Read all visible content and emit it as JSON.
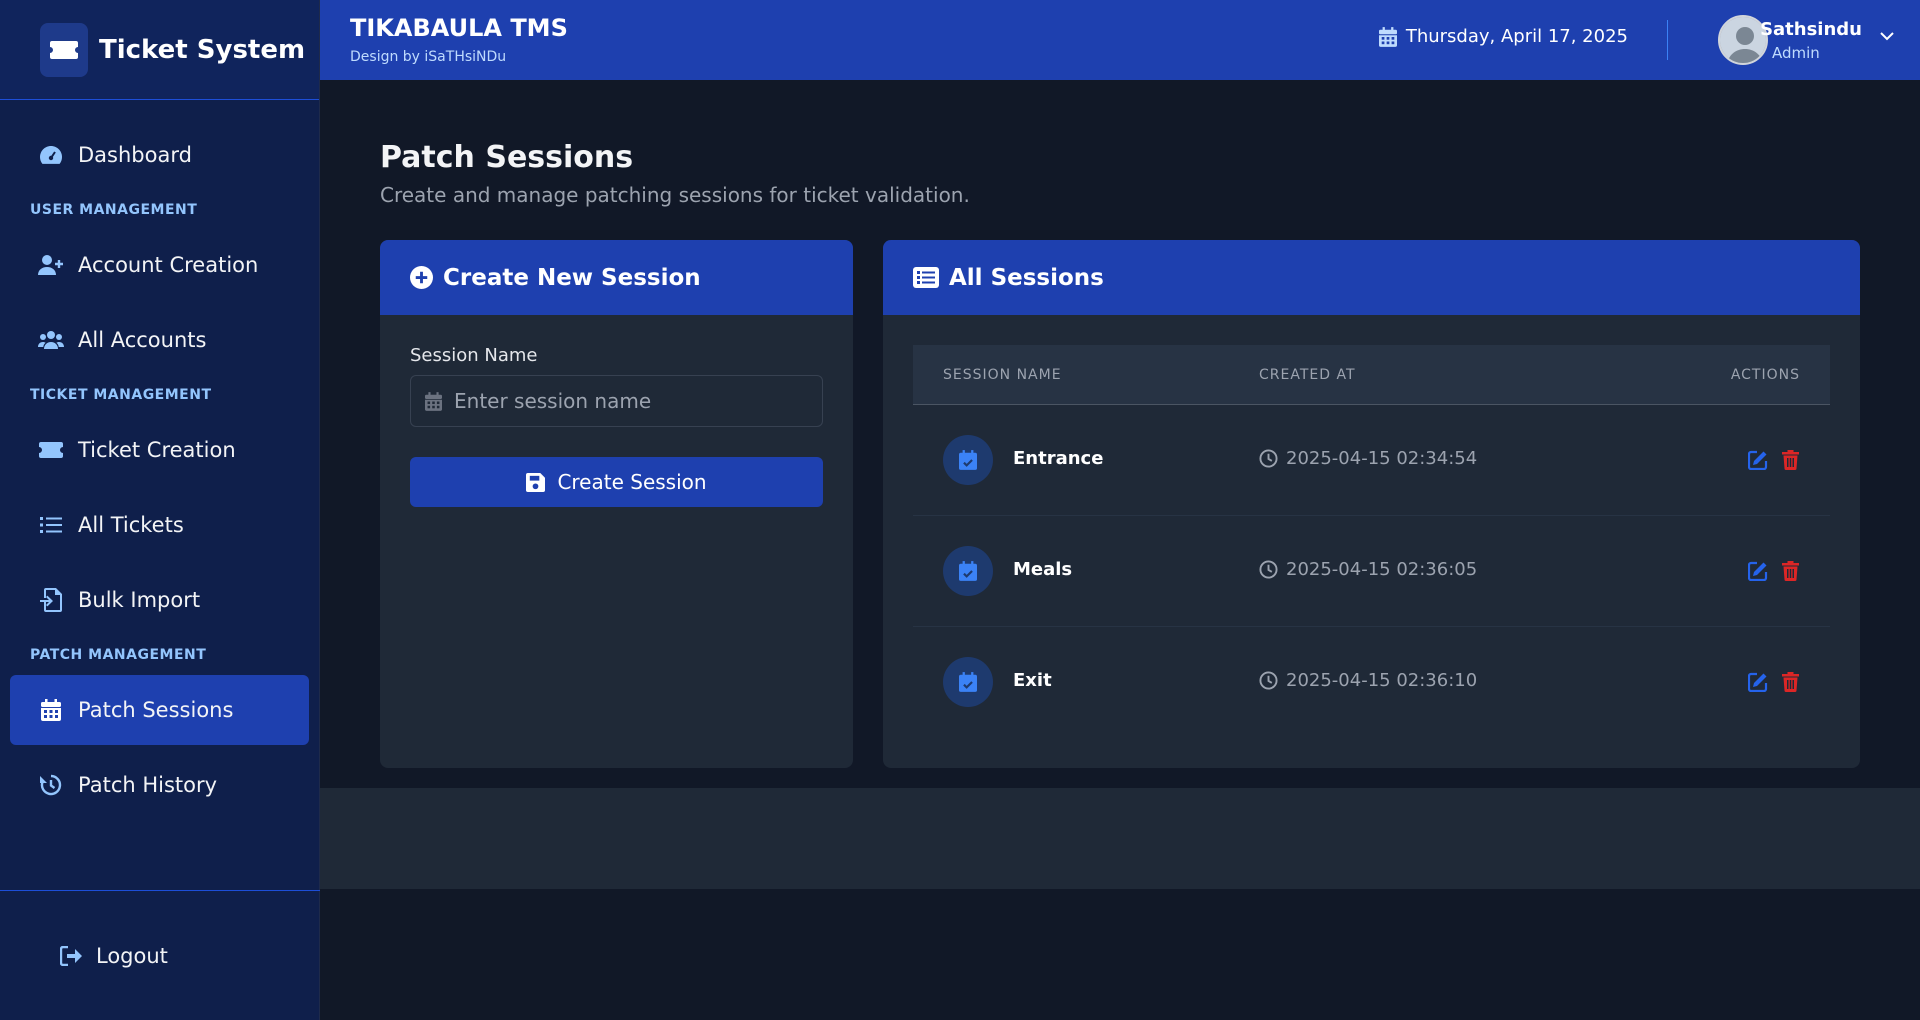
{
  "sidebar": {
    "brand": "Ticket System",
    "items": [
      {
        "label": "Dashboard"
      },
      {
        "label": "Account Creation"
      },
      {
        "label": "All Accounts"
      },
      {
        "label": "Ticket Creation"
      },
      {
        "label": "All Tickets"
      },
      {
        "label": "Bulk Import"
      },
      {
        "label": "Patch Sessions"
      },
      {
        "label": "Patch History"
      }
    ],
    "sections": {
      "user": "USER MANAGEMENT",
      "ticket": "TICKET MANAGEMENT",
      "patch": "PATCH MANAGEMENT"
    },
    "logout": "Logout",
    "active": "Patch Sessions"
  },
  "header": {
    "title": "TIKABAULA TMS",
    "subtitle": "Design by iSaTHsiNDu",
    "date": "Thursday, April 17, 2025",
    "user_name": "Sathsindu",
    "user_role": "Admin"
  },
  "page": {
    "title": "Patch Sessions",
    "subtitle": "Create and manage patching sessions for ticket validation."
  },
  "create_card": {
    "title": "Create New Session",
    "field_label": "Session Name",
    "placeholder": "Enter session name",
    "value": "",
    "button": "Create Session"
  },
  "sessions_card": {
    "title": "All Sessions",
    "columns": [
      "SESSION NAME",
      "CREATED AT",
      "ACTIONS"
    ],
    "rows": [
      {
        "name": "Entrance",
        "created_at": "2025-04-15 02:34:54"
      },
      {
        "name": "Meals",
        "created_at": "2025-04-15 02:36:05"
      },
      {
        "name": "Exit",
        "created_at": "2025-04-15 02:36:10"
      }
    ]
  },
  "colors": {
    "accent": "#1e40af",
    "edit": "#2563eb",
    "delete": "#dc2626",
    "background": "#111827",
    "card": "#1f2937"
  }
}
